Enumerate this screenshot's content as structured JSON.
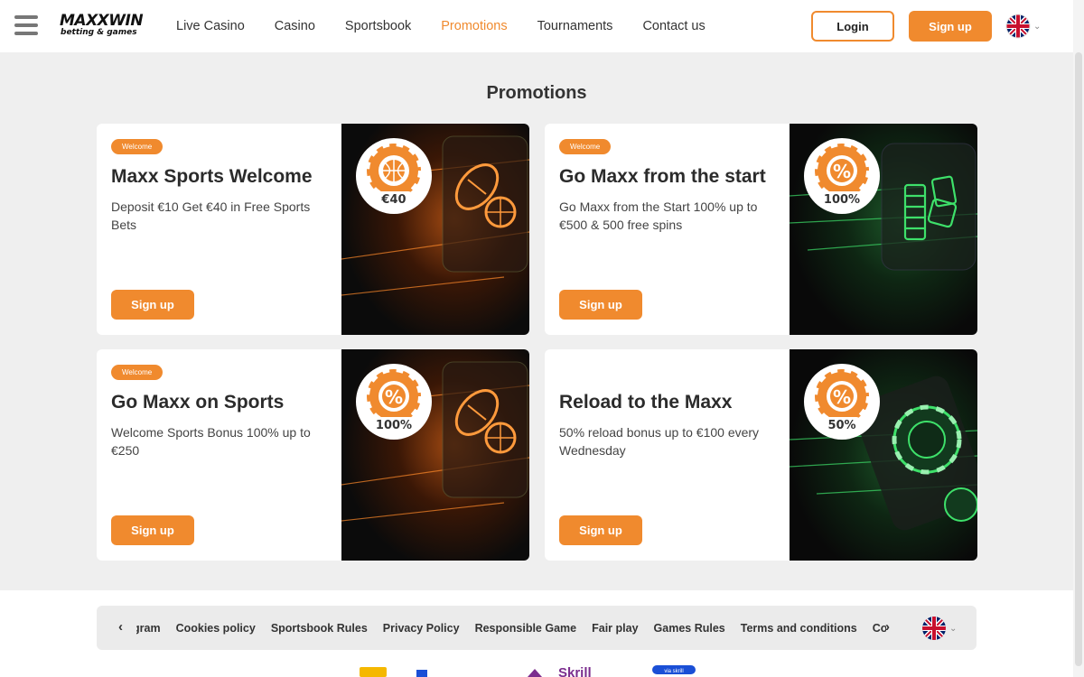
{
  "header": {
    "logo_text": "MAXXWIN",
    "logo_subtitle": "betting & games",
    "nav": [
      "Live Casino",
      "Casino",
      "Sportsbook",
      "Promotions",
      "Tournaments",
      "Contact us"
    ],
    "active_nav": "Promotions",
    "login_label": "Login",
    "signup_label": "Sign up"
  },
  "page": {
    "title": "Promotions"
  },
  "promotions": [
    {
      "badge": "Welcome",
      "title": "Maxx Sports Welcome",
      "description": "Deposit €10 Get €40 in Free Sports Bets",
      "button": "Sign up",
      "chip_label": "€40",
      "chip_icon": "basketball-icon",
      "theme": "orange-sports"
    },
    {
      "badge": "Welcome",
      "title": "Go Maxx from the start",
      "description": "Go Maxx from the Start 100% up to €500 & 500 free spins",
      "button": "Sign up",
      "chip_label": "100%",
      "chip_icon": "percent-icon",
      "theme": "green-casino"
    },
    {
      "badge": "Welcome",
      "title": "Go Maxx on Sports",
      "description": "Welcome Sports Bonus 100% up to €250",
      "button": "Sign up",
      "chip_label": "100%",
      "chip_icon": "percent-icon",
      "theme": "orange-sports"
    },
    {
      "badge": "",
      "title": "Reload to the Maxx",
      "description": "50% reload bonus up to €100 every Wednesday",
      "button": "Sign up",
      "chip_label": "50%",
      "chip_icon": "percent-icon",
      "theme": "green-casino"
    }
  ],
  "footer": {
    "links": [
      "gram",
      "Cookies policy",
      "Sportsbook Rules",
      "Privacy Policy",
      "Responsible Game",
      "Fair play",
      "Games Rules",
      "Terms and conditions",
      "Contact:"
    ],
    "prev_arrow": "‹",
    "next_arrow": "›",
    "payment_text": "Skrill",
    "payment_small": "via skrill"
  },
  "colors": {
    "accent": "#f08a2e",
    "background": "#efefef",
    "card_dark": "#0d0d0d",
    "glow_green": "#3ee06a"
  }
}
